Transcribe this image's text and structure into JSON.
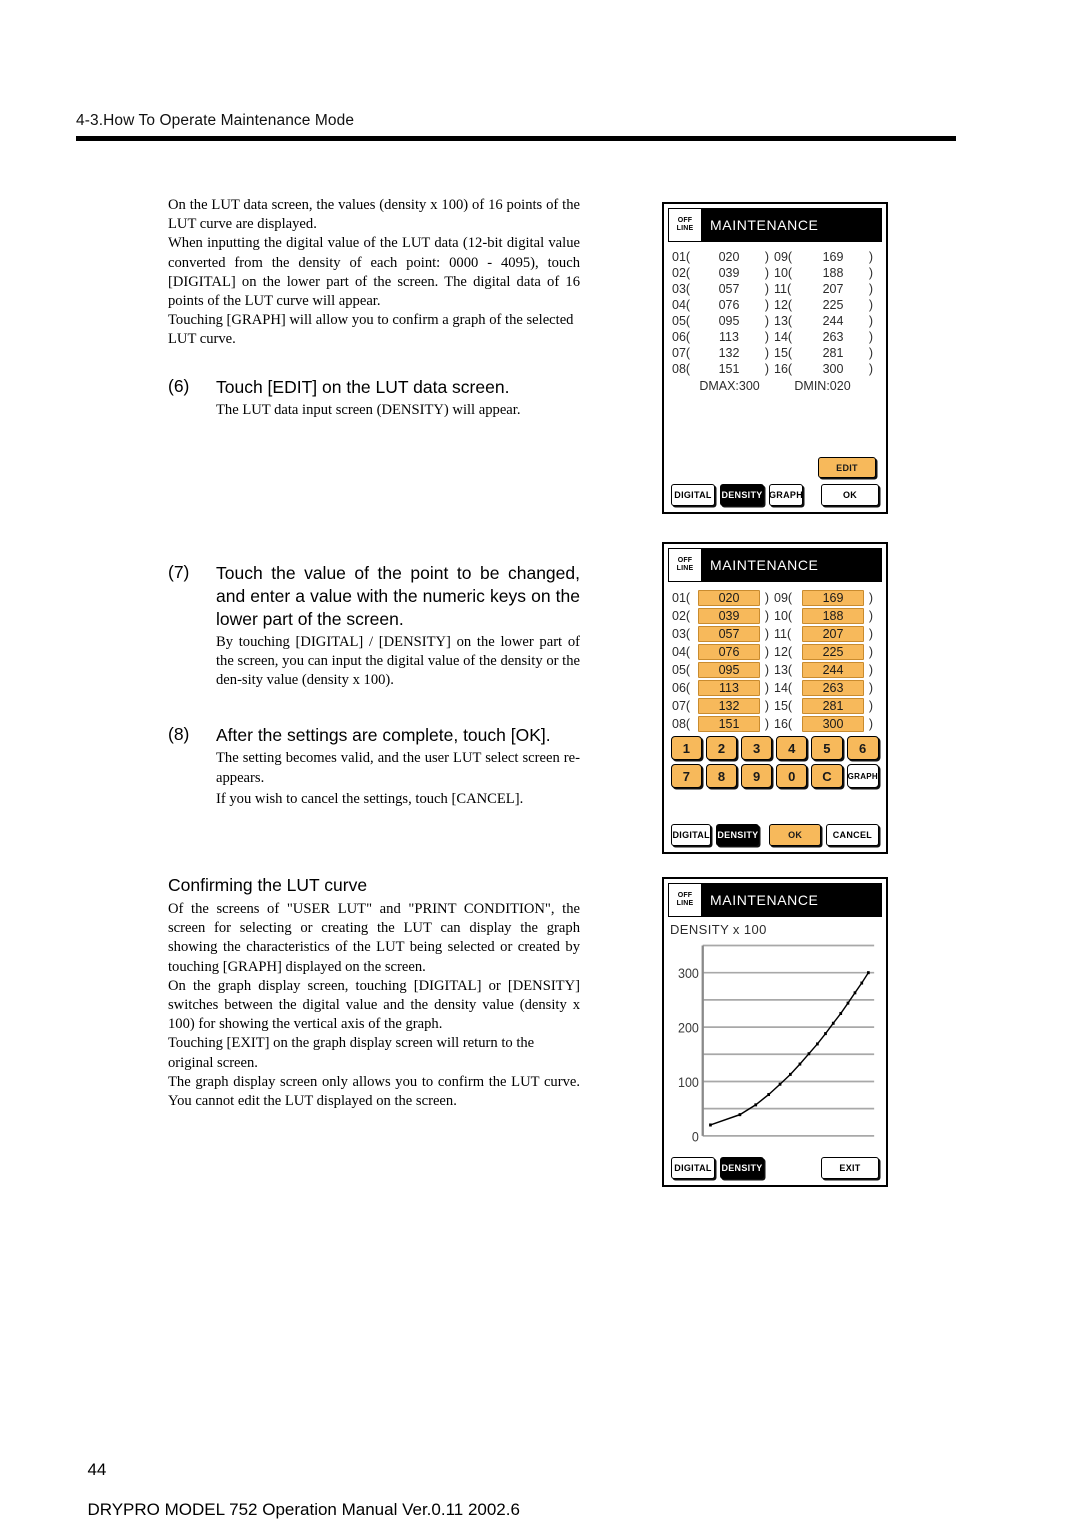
{
  "header": {
    "running_head": "4-3.How To Operate Maintenance Mode"
  },
  "footer": {
    "page_number": "44",
    "text": "DRYPRO MODEL 752 Operation Manual Ver.0.11 2002.6"
  },
  "body": {
    "intro_p1": "On the LUT data screen, the values (density x 100) of 16 points of the LUT curve are displayed.",
    "intro_p2": "When inputting the digital value of the LUT data (12-bit digital value converted from the density of each point: 0000 - 4095), touch [DIGITAL] on the lower part of the screen. The digital data of 16 points of the LUT curve will appear.",
    "intro_p3": "Touching [GRAPH] will allow you to confirm a graph of the selected LUT curve."
  },
  "steps": [
    {
      "num": "(6)",
      "title": "Touch [EDIT] on the LUT data screen.",
      "sub": "The LUT data input screen (DENSITY) will appear."
    },
    {
      "num": "(7)",
      "title": "Touch the value of the point to be changed, and enter a value with the numeric keys on the lower part of the screen.",
      "sub": "By touching [DIGITAL] / [DENSITY] on the lower part of the screen, you can input the digital value of the density or the den-sity value (density x 100)."
    },
    {
      "num": "(8)",
      "title": "After the settings are complete, touch [OK].",
      "sub": "The setting becomes valid, and the user LUT select screen re-appears.",
      "sub2": "If you wish to cancel the settings, touch [CANCEL]."
    }
  ],
  "section": {
    "heading": "Confirming the LUT curve",
    "p1": "Of the screens of \"USER LUT\" and \"PRINT CONDITION\", the screen for selecting or creating the LUT can display the graph showing the characteristics of the LUT being selected or created by touching [GRAPH] displayed on the screen.",
    "p2": "On the graph display screen, touching [DIGITAL] or [DENSITY] switches between the digital value and the density value (density x 100) for showing the vertical axis of the graph.",
    "p3": "Touching [EXIT] on the graph display screen will return to the original screen.",
    "p4": "The graph display screen only allows you to confirm the LUT curve. You cannot edit the LUT displayed on the screen."
  },
  "colors": {
    "highlight_orange": "#f7b95b",
    "highlight_border": "#c98b2e",
    "titlebar_black": "#000000",
    "gridline_gray": "#a8a8a8"
  },
  "screen1": {
    "offline_line1": "OFF",
    "offline_line2": "LINE",
    "title": "MAINTENANCE",
    "rows": [
      {
        "left_idx": "01(",
        "left_val": "020",
        "left_close": ")",
        "right_idx": "09(",
        "right_val": "169",
        "right_close": ")"
      },
      {
        "left_idx": "02(",
        "left_val": "039",
        "left_close": ")",
        "right_idx": "10(",
        "right_val": "188",
        "right_close": ")"
      },
      {
        "left_idx": "03(",
        "left_val": "057",
        "left_close": ")",
        "right_idx": "11(",
        "right_val": "207",
        "right_close": ")"
      },
      {
        "left_idx": "04(",
        "left_val": "076",
        "left_close": ")",
        "right_idx": "12(",
        "right_val": "225",
        "right_close": ")"
      },
      {
        "left_idx": "05(",
        "left_val": "095",
        "left_close": ")",
        "right_idx": "13(",
        "right_val": "244",
        "right_close": ")"
      },
      {
        "left_idx": "06(",
        "left_val": "113",
        "left_close": ")",
        "right_idx": "14(",
        "right_val": "263",
        "right_close": ")"
      },
      {
        "left_idx": "07(",
        "left_val": "132",
        "left_close": ")",
        "right_idx": "15(",
        "right_val": "281",
        "right_close": ")"
      },
      {
        "left_idx": "08(",
        "left_val": "151",
        "left_close": ")",
        "right_idx": "16(",
        "right_val": "300",
        "right_close": ")"
      }
    ],
    "dmax": "DMAX:300",
    "dmin": "DMIN:020",
    "edit_label": "EDIT",
    "buttons": {
      "digital": "DIGITAL",
      "density": "DENSITY",
      "graph": "GRAPH",
      "ok": "OK"
    }
  },
  "screen2": {
    "offline_line1": "OFF",
    "offline_line2": "LINE",
    "title": "MAINTENANCE",
    "rows": [
      {
        "left_idx": "01(",
        "left_val": "020",
        "left_close": ")",
        "right_idx": "09(",
        "right_val": "169",
        "right_close": ")"
      },
      {
        "left_idx": "02(",
        "left_val": "039",
        "left_close": ")",
        "right_idx": "10(",
        "right_val": "188",
        "right_close": ")"
      },
      {
        "left_idx": "03(",
        "left_val": "057",
        "left_close": ")",
        "right_idx": "11(",
        "right_val": "207",
        "right_close": ")"
      },
      {
        "left_idx": "04(",
        "left_val": "076",
        "left_close": ")",
        "right_idx": "12(",
        "right_val": "225",
        "right_close": ")"
      },
      {
        "left_idx": "05(",
        "left_val": "095",
        "left_close": ")",
        "right_idx": "13(",
        "right_val": "244",
        "right_close": ")"
      },
      {
        "left_idx": "06(",
        "left_val": "113",
        "left_close": ")",
        "right_idx": "14(",
        "right_val": "263",
        "right_close": ")"
      },
      {
        "left_idx": "07(",
        "left_val": "132",
        "left_close": ")",
        "right_idx": "15(",
        "right_val": "281",
        "right_close": ")"
      },
      {
        "left_idx": "08(",
        "left_val": "151",
        "left_close": ")",
        "right_idx": "16(",
        "right_val": "300",
        "right_close": ")"
      }
    ],
    "keys": [
      "1",
      "2",
      "3",
      "4",
      "5",
      "6",
      "7",
      "8",
      "9",
      "0",
      "C",
      "GRAPH"
    ],
    "buttons": {
      "digital": "DIGITAL",
      "density": "DENSITY",
      "ok": "OK",
      "cancel": "CANCEL"
    }
  },
  "screen3": {
    "offline_line1": "OFF",
    "offline_line2": "LINE",
    "title": "MAINTENANCE",
    "axis_caption": "DENSITY x  100",
    "buttons": {
      "digital": "DIGITAL",
      "density": "DENSITY",
      "exit": "EXIT"
    },
    "chart_data": {
      "type": "line",
      "title": "DENSITY x 100",
      "xlabel": "",
      "ylabel": "DENSITY x 100",
      "ylim": [
        0,
        350
      ],
      "yticks": [
        0,
        100,
        200,
        300
      ],
      "gridlines": [
        0,
        50,
        100,
        150,
        200,
        250,
        300,
        350
      ],
      "grid": true,
      "legend": "none",
      "x": [
        1,
        2,
        3,
        4,
        5,
        6,
        7,
        8,
        9,
        10,
        11,
        12,
        13,
        14,
        15,
        16
      ],
      "values": [
        20,
        39,
        57,
        76,
        95,
        113,
        132,
        151,
        169,
        188,
        207,
        225,
        244,
        263,
        281,
        300
      ],
      "markers": true,
      "note": "LUT curve plotted convex/increasing; markers denser at low x"
    }
  }
}
